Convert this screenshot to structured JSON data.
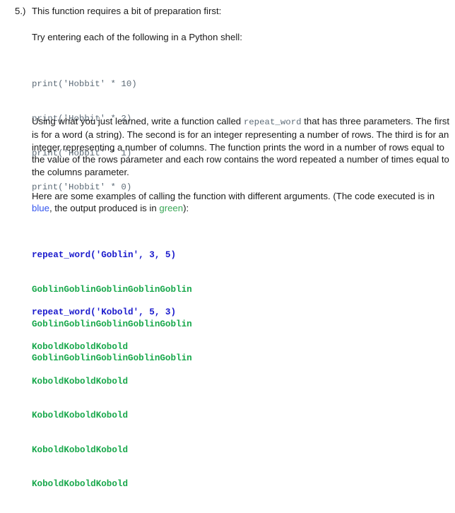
{
  "document": {
    "background_color": "#ffffff",
    "text_color": "#1a1a1a"
  },
  "question": {
    "number": "5.)",
    "title": "This function requires a bit of preparation first:"
  },
  "lead_in": "Try entering each of the following in a Python shell:",
  "shell_code": {
    "color": "#5d6b77",
    "lines": [
      "print('Hobbit' * 10)",
      "print('Hobbit' * 2)",
      "print('Hobbit' * 1)",
      "print('Hobbit' * 0)"
    ]
  },
  "prompt_paragraph": {
    "part1": "Using what you just learned, write a function called ",
    "function_name": "repeat_word",
    "part2": " that has three parameters.  The first is for a word (a string).  The second is for an integer representing a number of rows.  The third is for an integer representing a number of columns.  The function prints the word in a number of rows equal to the value of the rows parameter and each row contains the word repeated a number of times equal to the columns parameter."
  },
  "examples_paragraph": {
    "part1": "Here are some examples of calling the function with different arguments.  (The code executed is in ",
    "blue_word": "blue",
    "part2": ", the output produced is in ",
    "green_word": "green",
    "part3": "):"
  },
  "colors": {
    "code_blue": "#1a1acc",
    "output_green": "#19a84c",
    "inline_blue": "#3355ee",
    "inline_green": "#3aa757",
    "shell_gray": "#5d6b77"
  },
  "examples": [
    {
      "call": "repeat_word('Goblin', 3, 5)",
      "output": [
        "GoblinGoblinGoblinGoblinGoblin",
        "GoblinGoblinGoblinGoblinGoblin",
        "GoblinGoblinGoblinGoblinGoblin"
      ]
    },
    {
      "call": "repeat_word('Kobold', 5, 3)",
      "output": [
        "KoboldKoboldKobold",
        "KoboldKoboldKobold",
        "KoboldKoboldKobold",
        "KoboldKoboldKobold",
        "KoboldKoboldKobold"
      ]
    }
  ]
}
